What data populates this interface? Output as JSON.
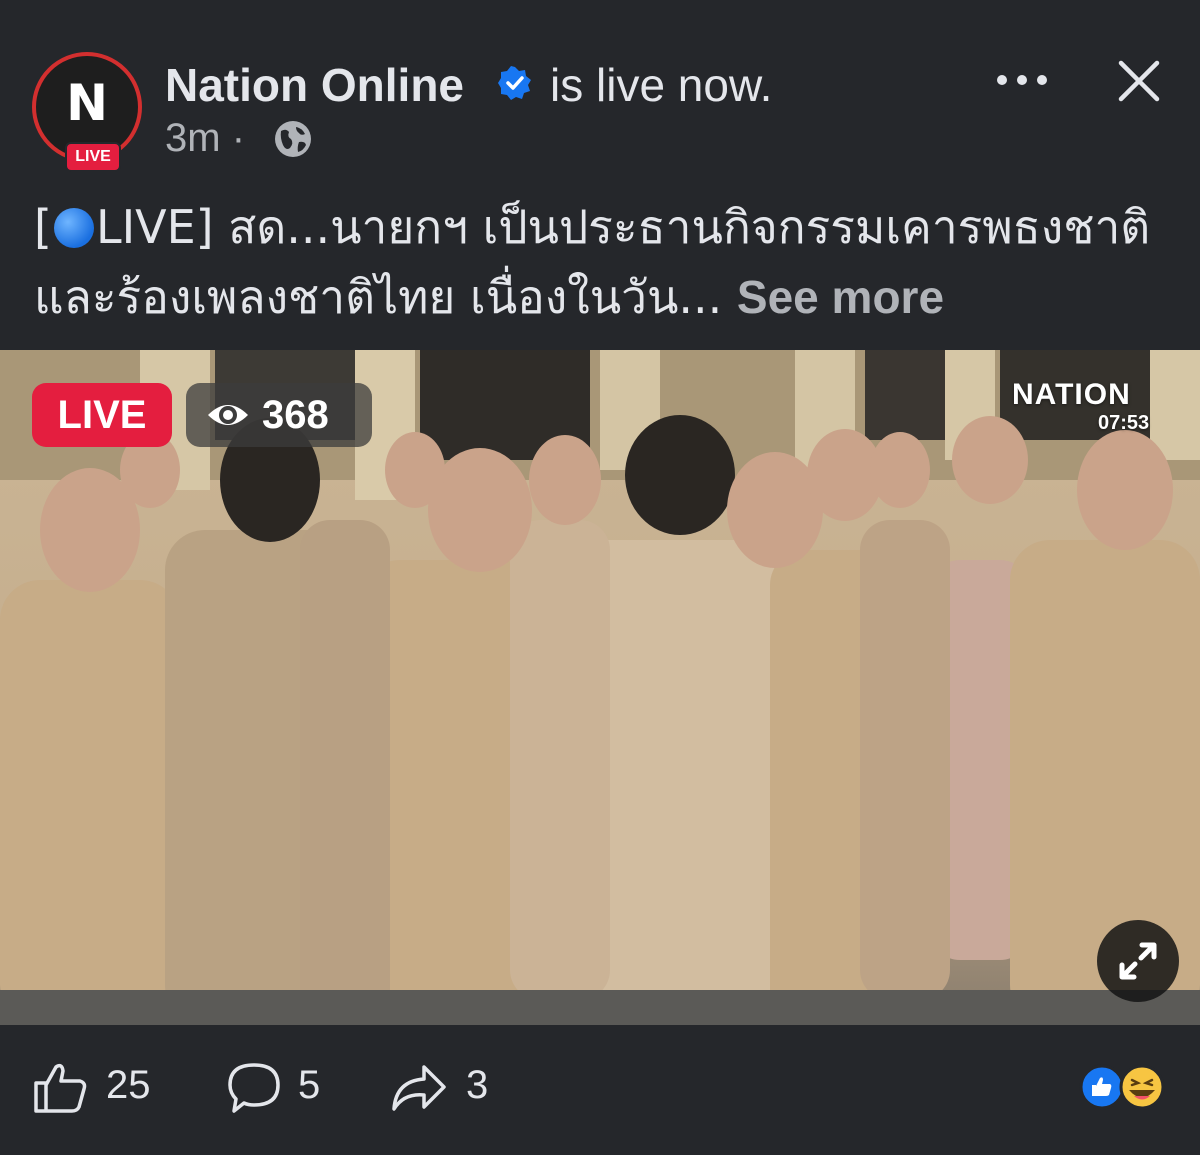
{
  "post": {
    "page_name": "Nation Online",
    "status_text": "is live now.",
    "time": "3m",
    "separator": "·",
    "avatar": {
      "letter": "N",
      "badge": "LIVE"
    },
    "caption_prefix_open": "[",
    "caption_prefix_close": "LIVE]",
    "caption_text": "  สด...นายกฯ เป็นประธานกิจกรรมเคารพธงชาติและร้องเพลงชาติไทย เนื่องในวัน...",
    "see_more": "See more"
  },
  "video": {
    "live_label": "LIVE",
    "viewer_count": "368",
    "channel_logo": "NATION",
    "channel_time": "07:53"
  },
  "actions": {
    "likes": "25",
    "comments": "5",
    "shares": "3"
  },
  "icons": {
    "verified": "verified-badge-icon",
    "globe": "globe-icon",
    "more": "more-horizontal-icon",
    "close": "close-icon",
    "eye": "eye-icon",
    "expand": "expand-icon",
    "like": "like-thumb-icon",
    "comment": "comment-icon",
    "share": "share-icon"
  },
  "colors": {
    "background": "#25272b",
    "live_red": "#e41e3f",
    "verified_blue": "#1877f2",
    "secondary_text": "#b0b3b8"
  }
}
